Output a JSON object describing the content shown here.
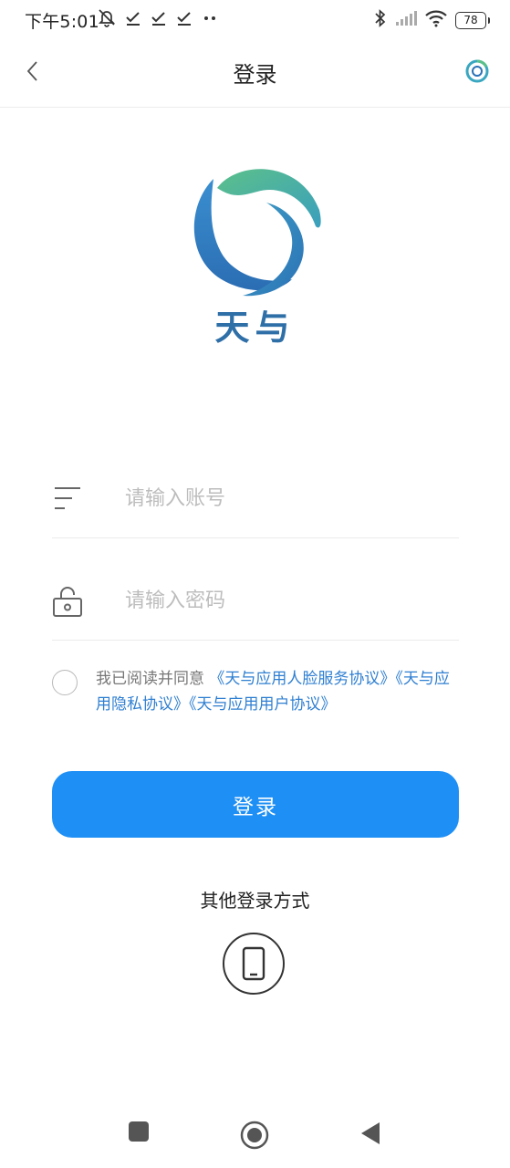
{
  "status_bar": {
    "time": "下午5:01",
    "battery": "78"
  },
  "nav": {
    "title": "登录"
  },
  "brand": {
    "name": "天与"
  },
  "form": {
    "account_placeholder": "请输入账号",
    "password_placeholder": "请输入密码"
  },
  "agreement": {
    "prefix": "我已阅读并同意",
    "links": [
      "《天与应用人脸服务协议》",
      "《天与应用隐私协议》",
      "《天与应用用户协议》"
    ]
  },
  "login_button": "登录",
  "other_login": {
    "label": "其他登录方式"
  },
  "colors": {
    "primary": "#1e8ff5",
    "link": "#2f7fd1",
    "brand_text": "#2f6fa8",
    "logo_green": "#5cc08a",
    "logo_blue": "#2b72b7"
  }
}
